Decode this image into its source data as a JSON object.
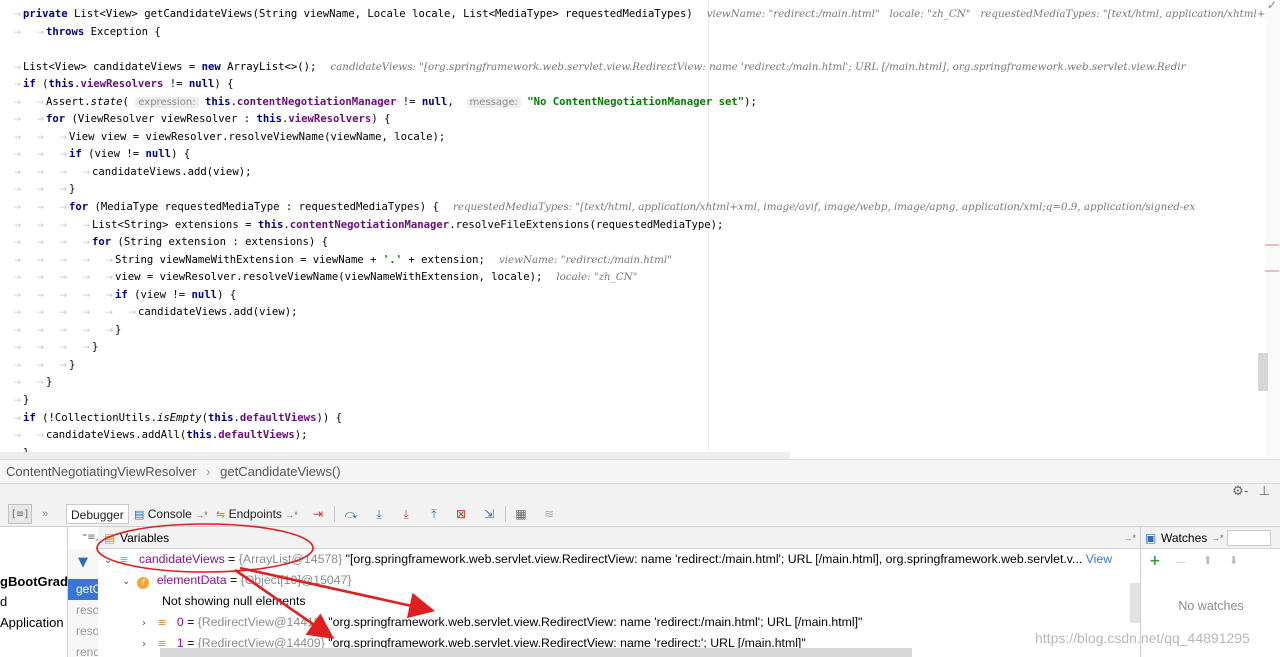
{
  "editor": {
    "lines": [
      {
        "tokens": [
          {
            "t": "private ",
            "c": "kw"
          },
          {
            "t": "List<View> getCandidateViews(String viewName, Locale locale, List<MediaType> requestedMediaTypes)"
          }
        ],
        "inline": "viewName: \"redirect:/main.html\"   locale: \"zh_CN\"   requestedMediaTypes: \"[text/html, application/xhtml+xml\""
      },
      {
        "tokens": [
          {
            "t": "throws ",
            "c": "kw"
          },
          {
            "t": "Exception {"
          }
        ]
      },
      {
        "tokens": []
      },
      {
        "tokens": [
          {
            "t": "List<View> candidateViews = "
          },
          {
            "t": "new ",
            "c": "kw"
          },
          {
            "t": "ArrayList<>();"
          }
        ],
        "inline": "candidateViews: \"[org.springframework.web.servlet.view.RedirectView: name 'redirect:/main.html'; URL [/main.html], org.springframework.web.servlet.view.Redir"
      },
      {
        "tokens": [
          {
            "t": "if ",
            "c": "kw"
          },
          {
            "t": "("
          },
          {
            "t": "this",
            "c": "kw"
          },
          {
            "t": "."
          },
          {
            "t": "viewResolvers",
            "c": "fld"
          },
          {
            "t": " != "
          },
          {
            "t": "null",
            "c": "kw"
          },
          {
            "t": ") {"
          }
        ]
      },
      {
        "tokens": [
          {
            "t": "Assert."
          },
          {
            "t": "state",
            "c": "it"
          },
          {
            "t": "( "
          },
          {
            "t": "expression:",
            "c": "hint"
          },
          {
            "t": " "
          },
          {
            "t": "this",
            "c": "kw"
          },
          {
            "t": "."
          },
          {
            "t": "contentNegotiationManager",
            "c": "fld"
          },
          {
            "t": " != "
          },
          {
            "t": "null",
            "c": "kw"
          },
          {
            "t": ",  "
          },
          {
            "t": "message:",
            "c": "hint"
          },
          {
            "t": " "
          },
          {
            "t": "\"No ContentNegotiationManager set\"",
            "c": "str"
          },
          {
            "t": ");"
          }
        ]
      },
      {
        "tokens": [
          {
            "t": "for ",
            "c": "kw"
          },
          {
            "t": "(ViewResolver viewResolver : "
          },
          {
            "t": "this",
            "c": "kw"
          },
          {
            "t": "."
          },
          {
            "t": "viewResolvers",
            "c": "fld"
          },
          {
            "t": ") {"
          }
        ]
      },
      {
        "tokens": [
          {
            "t": "View view = viewResolver.resolveViewName(viewName, locale);"
          }
        ]
      },
      {
        "tokens": [
          {
            "t": "if ",
            "c": "kw"
          },
          {
            "t": "(view != "
          },
          {
            "t": "null",
            "c": "kw"
          },
          {
            "t": ") {"
          }
        ]
      },
      {
        "tokens": [
          {
            "t": "candidateViews.add(view);"
          }
        ]
      },
      {
        "tokens": [
          {
            "t": "}"
          }
        ]
      },
      {
        "tokens": [
          {
            "t": "for ",
            "c": "kw"
          },
          {
            "t": "(MediaType requestedMediaType : requestedMediaTypes) {"
          }
        ],
        "inline": "requestedMediaTypes: \"[text/html, application/xhtml+xml, image/avif, image/webp, image/apng, application/xml;q=0.9, application/signed-ex"
      },
      {
        "tokens": [
          {
            "t": "List<String> extensions = "
          },
          {
            "t": "this",
            "c": "kw"
          },
          {
            "t": "."
          },
          {
            "t": "contentNegotiationManager",
            "c": "fld"
          },
          {
            "t": ".resolveFileExtensions(requestedMediaType);"
          }
        ]
      },
      {
        "tokens": [
          {
            "t": "for ",
            "c": "kw"
          },
          {
            "t": "(String extension : extensions) {"
          }
        ]
      },
      {
        "tokens": [
          {
            "t": "String viewNameWithExtension = viewName + "
          },
          {
            "t": "'.'",
            "c": "str"
          },
          {
            "t": " + extension;"
          }
        ],
        "inline": "viewName: \"redirect:/main.html\""
      },
      {
        "tokens": [
          {
            "t": "view = viewResolver.resolveViewName(viewNameWithExtension, locale);"
          }
        ],
        "inline": "locale: \"zh_CN\""
      },
      {
        "tokens": [
          {
            "t": "if ",
            "c": "kw"
          },
          {
            "t": "(view != "
          },
          {
            "t": "null",
            "c": "kw"
          },
          {
            "t": ") {"
          }
        ]
      },
      {
        "tokens": [
          {
            "t": "candidateViews.add(view);"
          }
        ]
      },
      {
        "tokens": [
          {
            "t": "}"
          }
        ]
      },
      {
        "tokens": [
          {
            "t": "}"
          }
        ]
      },
      {
        "tokens": [
          {
            "t": "}"
          }
        ]
      },
      {
        "tokens": [
          {
            "t": "}"
          }
        ]
      },
      {
        "tokens": [
          {
            "t": "}"
          }
        ]
      },
      {
        "tokens": [
          {
            "t": "if ",
            "c": "kw"
          },
          {
            "t": "(!CollectionUtils."
          },
          {
            "t": "isEmpty",
            "c": "it"
          },
          {
            "t": "("
          },
          {
            "t": "this",
            "c": "kw"
          },
          {
            "t": "."
          },
          {
            "t": "defaultViews",
            "c": "fld"
          },
          {
            "t": ")) {"
          }
        ]
      },
      {
        "tokens": [
          {
            "t": "candidateViews.addAll("
          },
          {
            "t": "this",
            "c": "kw"
          },
          {
            "t": "."
          },
          {
            "t": "defaultViews",
            "c": "fld"
          },
          {
            "t": ");"
          }
        ]
      },
      {
        "tokens": [
          {
            "t": "}"
          }
        ]
      }
    ],
    "indents": [
      1,
      2,
      0,
      1,
      1,
      2,
      2,
      3,
      3,
      4,
      3,
      3,
      4,
      4,
      5,
      5,
      5,
      6,
      5,
      4,
      3,
      2,
      1,
      1,
      2,
      1
    ],
    "tops": [
      6,
      24,
      41,
      59,
      76,
      94,
      111,
      129,
      146,
      164,
      181,
      199,
      217,
      234,
      252,
      269,
      287,
      304,
      322,
      339,
      357,
      374,
      392,
      410,
      427,
      445
    ]
  },
  "breadcrumb": {
    "class_name": "ContentNegotiatingViewResolver",
    "method_name": "getCandidateViews()",
    "separator": "›"
  },
  "toolbar": {
    "debugger_tab": "Debugger",
    "console_tab": "Console",
    "console_suffix": "→*",
    "endpoints_tab": "Endpoints",
    "endpoints_suffix": "→*",
    "overflow": "»",
    "settings": "⚙-",
    "hide": "⊥",
    "layout_icon": "[≡]"
  },
  "frames": {
    "texts": [
      "gBootGradu",
      "d",
      "Application"
    ],
    "rows": [
      "getC",
      "reso",
      "reso",
      "rend"
    ],
    "menu": "⁼≡,"
  },
  "variables": {
    "header": "Variables",
    "header_suffix": "→*",
    "filter_icon": "filter-icon",
    "rows": [
      {
        "name": "candidateViews",
        "meta": "{ArrayList@14578}",
        "value": "\"[org.springframework.web.servlet.view.RedirectView: name 'redirect:/main.html'; URL [/main.html], org.springframework.web.servlet.v...",
        "link": "View"
      },
      {
        "name": "elementData",
        "meta": "{Object[10]@15047}",
        "value": ""
      },
      {
        "name": "",
        "meta": "",
        "value": "Not showing null elements"
      },
      {
        "name": "0",
        "meta": "{RedirectView@14410}",
        "value": "\"org.springframework.web.servlet.view.RedirectView: name 'redirect:/main.html'; URL [/main.html]\""
      },
      {
        "name": "1",
        "meta": "{RedirectView@14409}",
        "value": "\"org.springframework.web.servlet.view.RedirectView: name 'redirect:'; URL [/main.html]\""
      }
    ],
    "eq": " = "
  },
  "watches": {
    "header": "Watches",
    "header_suffix": "→*",
    "empty": "No watches",
    "add": "+",
    "remove": "—",
    "up": "⬆",
    "down": "⬇"
  },
  "watermark": "https://blog.csdn.net/qq_44891295",
  "colors": {
    "keyword": "#000080",
    "field": "#660e7a",
    "string": "#008000",
    "selection": "#3875d7",
    "annotation_red": "#e02020",
    "variable_name": "#871094"
  },
  "annotations": {
    "oval_target": "candidateViews",
    "arrow_count": 2
  }
}
